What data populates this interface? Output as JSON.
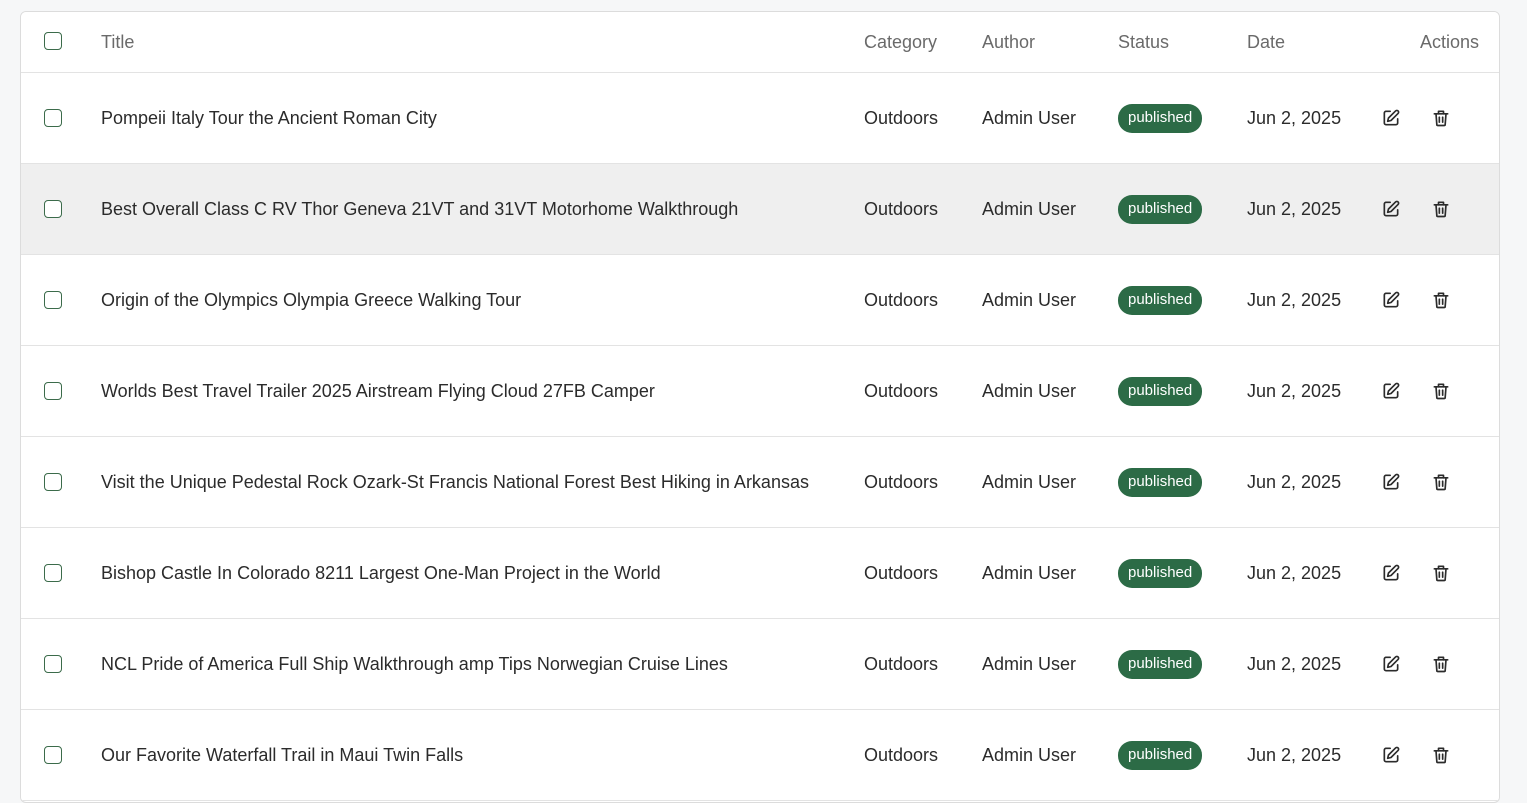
{
  "table": {
    "columns": {
      "title": "Title",
      "category": "Category",
      "author": "Author",
      "status": "Status",
      "date": "Date",
      "actions": "Actions"
    },
    "rows": [
      {
        "title": "Pompeii Italy Tour the Ancient Roman City",
        "category": "Outdoors",
        "author": "Admin User",
        "status": "published",
        "date": "Jun 2, 2025"
      },
      {
        "title": "Best Overall Class C RV Thor Geneva 21VT and 31VT Motorhome Walkthrough",
        "category": "Outdoors",
        "author": "Admin User",
        "status": "published",
        "date": "Jun 2, 2025"
      },
      {
        "title": "Origin of the Olympics Olympia Greece Walking Tour",
        "category": "Outdoors",
        "author": "Admin User",
        "status": "published",
        "date": "Jun 2, 2025"
      },
      {
        "title": "Worlds Best Travel Trailer 2025 Airstream Flying Cloud 27FB Camper",
        "category": "Outdoors",
        "author": "Admin User",
        "status": "published",
        "date": "Jun 2, 2025"
      },
      {
        "title": "Visit the Unique Pedestal Rock Ozark-St Francis National Forest Best Hiking in Arkansas",
        "category": "Outdoors",
        "author": "Admin User",
        "status": "published",
        "date": "Jun 2, 2025"
      },
      {
        "title": "Bishop Castle In Colorado 8211 Largest One-Man Project in the World",
        "category": "Outdoors",
        "author": "Admin User",
        "status": "published",
        "date": "Jun 2, 2025"
      },
      {
        "title": "NCL Pride of America Full Ship Walkthrough amp Tips Norwegian Cruise Lines",
        "category": "Outdoors",
        "author": "Admin User",
        "status": "published",
        "date": "Jun 2, 2025"
      },
      {
        "title": "Our Favorite Waterfall Trail in Maui Twin Falls",
        "category": "Outdoors",
        "author": "Admin User",
        "status": "published",
        "date": "Jun 2, 2025"
      }
    ],
    "row_icons": {
      "edit": "edit-icon",
      "delete": "trash-icon"
    }
  },
  "colors": {
    "status_published": "#2c6b46",
    "checkbox_border": "#3b6b4a",
    "highlight_row": "#efefef"
  }
}
